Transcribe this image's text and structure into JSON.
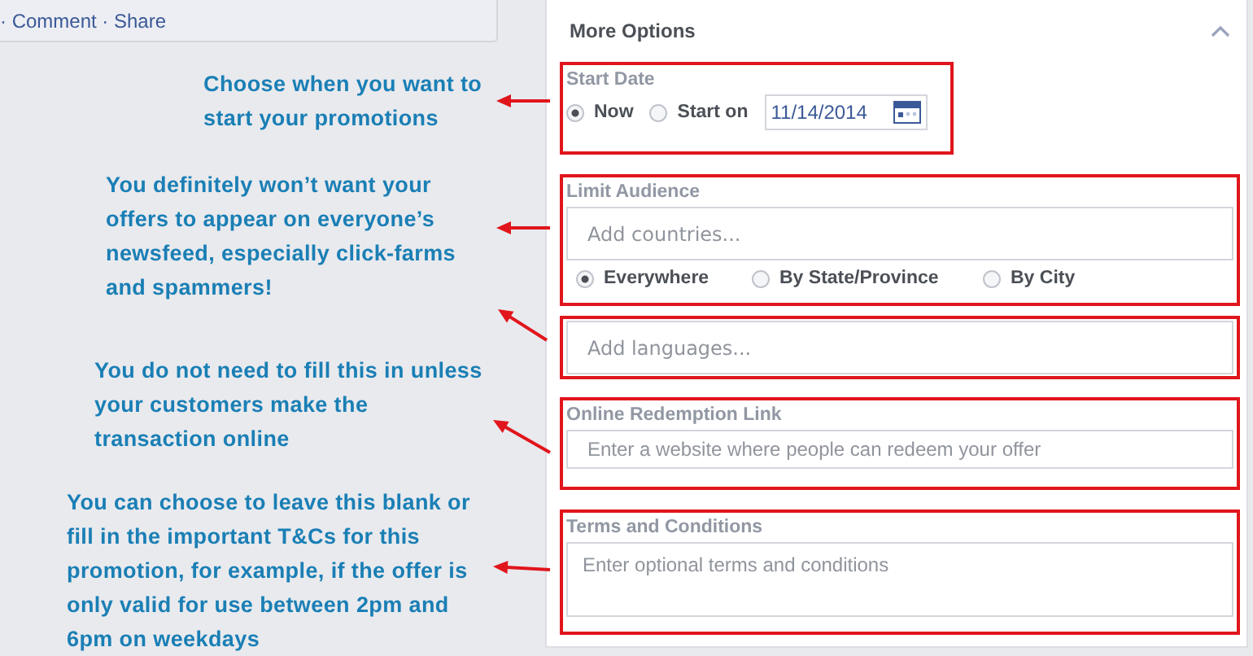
{
  "post_actions": "· Comment · Share",
  "notes": [
    "Choose when you want to start your promotions",
    "You definitely won’t want your offers to appear on everyone’s newsfeed, especially click-farms and spammers!",
    "You do not need to fill this in unless your customers make the transaction online",
    "You can choose to leave this blank or fill in the important T&Cs for this promotion, for example, if the offer is only valid for use between 2pm and 6pm on weekdays"
  ],
  "panel": {
    "title": "More Options",
    "expanded": true,
    "start_date": {
      "label": "Start Date",
      "options": [
        {
          "label": "Now",
          "selected": true
        },
        {
          "label": "Start on",
          "selected": false
        }
      ],
      "date": "11/14/2014"
    },
    "limit_audience": {
      "label": "Limit Audience",
      "countries_placeholder": "Add countries...",
      "options": [
        {
          "label": "Everywhere",
          "selected": true
        },
        {
          "label": "By State/Province",
          "selected": false
        },
        {
          "label": "By City",
          "selected": false
        }
      ],
      "languages_placeholder": "Add languages..."
    },
    "redemption": {
      "label": "Online Redemption Link",
      "placeholder": "Enter a website where people can redeem your offer"
    },
    "terms": {
      "label": "Terms and Conditions",
      "placeholder": "Enter optional terms and conditions"
    }
  }
}
